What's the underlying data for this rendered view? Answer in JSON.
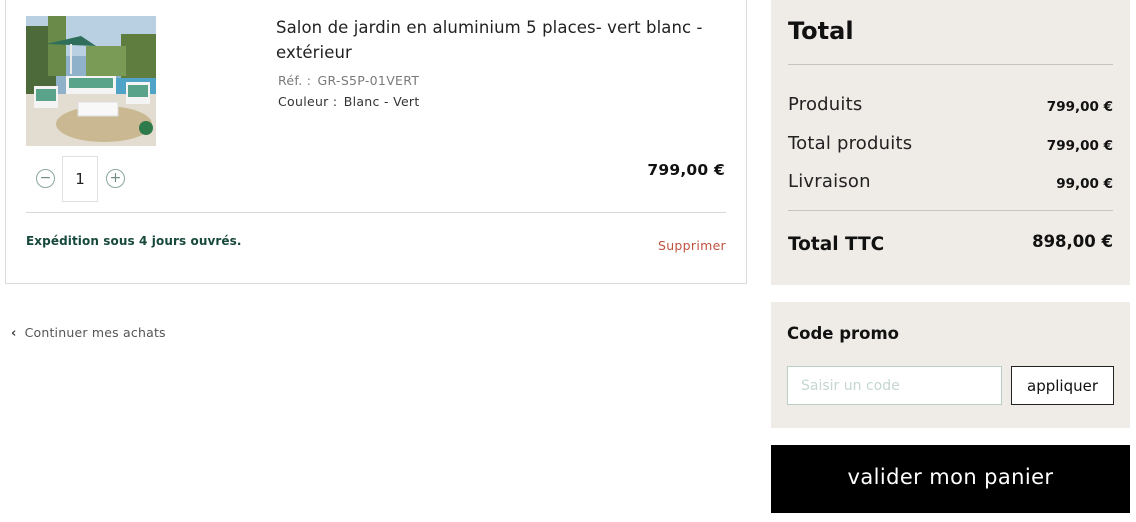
{
  "cart_item": {
    "image_alt": "Salon de jardin vert et blanc",
    "title": "Salon de jardin en aluminium 5 places- vert blanc - extérieur",
    "ref_label": "Réf. :",
    "ref_value": "GR-S5P-01VERT",
    "color_label": "Couleur :",
    "color_value": "Blanc - Vert",
    "quantity": "1",
    "qty_minus": "−",
    "qty_plus": "+",
    "price": "799,00 €",
    "shipping_note": "Expédition sous 4 jours ouvrés.",
    "remove_label": "Supprimer"
  },
  "continue_link": {
    "chevron": "‹",
    "label": "Continuer mes achats"
  },
  "summary": {
    "title": "Total",
    "rows": [
      {
        "label": "Produits",
        "value": "799,00 €"
      },
      {
        "label": "Total produits",
        "value": "799,00 €"
      },
      {
        "label": "Livraison",
        "value": "99,00 €"
      }
    ],
    "total_label": "Total TTC",
    "total_value": "898,00 €"
  },
  "promo": {
    "title": "Code promo",
    "placeholder": "Saisir un code",
    "apply_label": "appliquer"
  },
  "checkout": {
    "label": "valider mon panier"
  },
  "colors": {
    "accent_green": "#17483c",
    "remove_red": "#c0523f",
    "panel_bg": "#efebe7",
    "checkout_bg": "#000000"
  }
}
